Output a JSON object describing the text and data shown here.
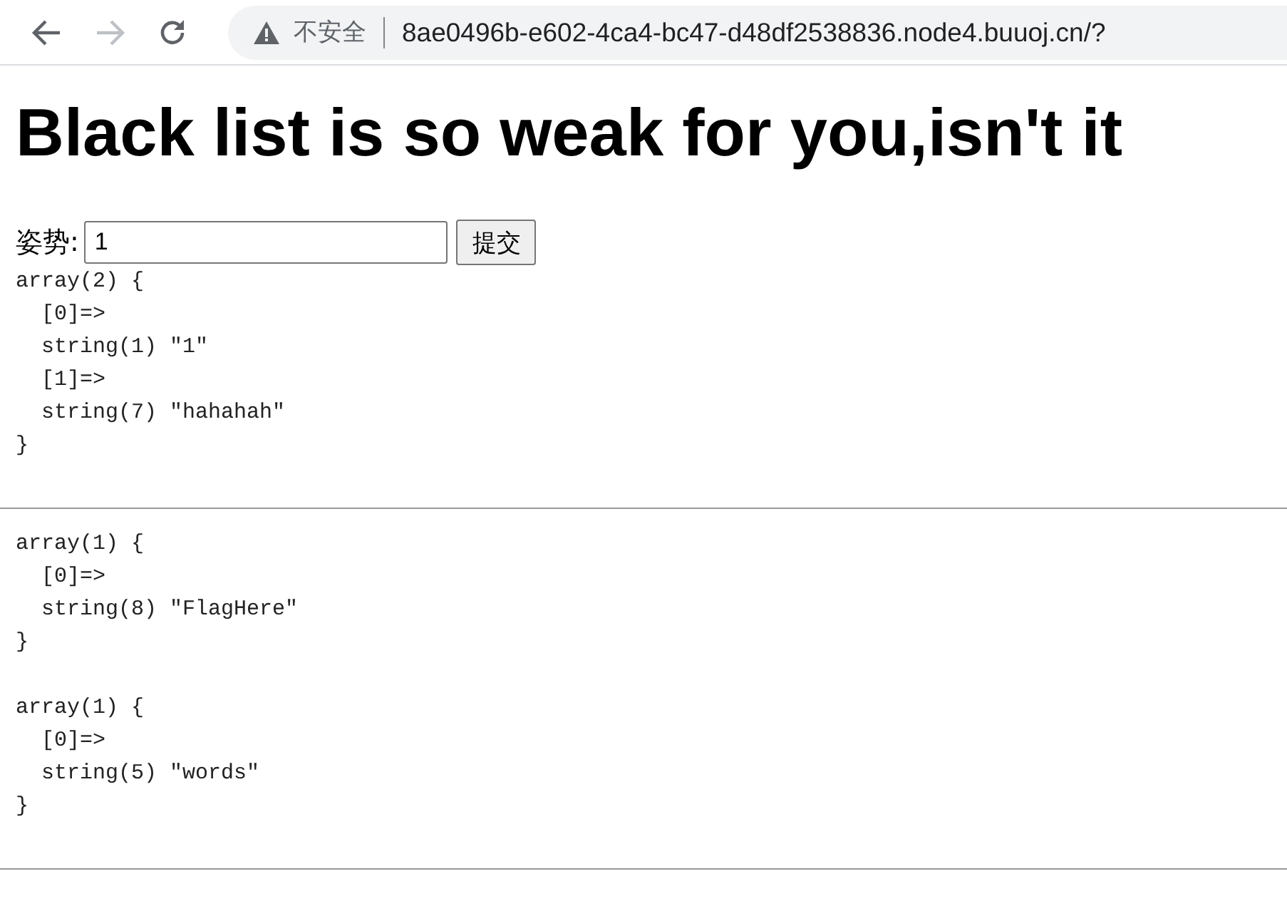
{
  "browser": {
    "back": {
      "disabled": false
    },
    "forward": {
      "disabled": true
    },
    "security_label": "不安全",
    "url": "8ae0496b-e602-4ca4-bc47-d48df2538836.node4.buuoj.cn/?"
  },
  "heading": "Black list is so weak for you,isn't it",
  "form": {
    "label": "姿势:",
    "value": "1",
    "button": "提交"
  },
  "sections": [
    {
      "dumps": [
        {
          "lines": [
            "array(2) {",
            "  [0]=>",
            "  string(1) \"1\"",
            "  [1]=>",
            "  string(7) \"hahahah\"",
            "}"
          ]
        }
      ]
    },
    {
      "dumps": [
        {
          "lines": [
            "array(1) {",
            "  [0]=>",
            "  string(8) \"FlagHere\"",
            "}"
          ]
        },
        {
          "lines": [
            "array(1) {",
            "  [0]=>",
            "  string(5) \"words\"",
            "}"
          ]
        }
      ]
    }
  ]
}
